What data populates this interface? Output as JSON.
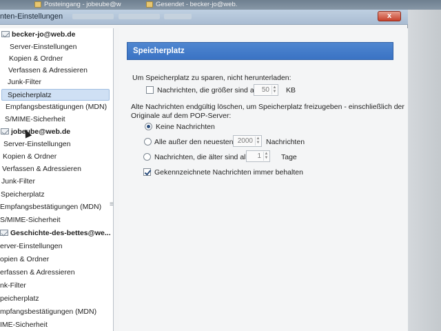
{
  "tabs": [
    {
      "label": "Posteingang - jobeube@w"
    },
    {
      "label": "Gesendet - becker-jo@web."
    }
  ],
  "window": {
    "title": "nten-Einstellungen",
    "close_label": "x"
  },
  "tree": {
    "rows": [
      {
        "label": "becker-jo@web.de",
        "type": "account"
      },
      {
        "label": "Server-Einstellungen",
        "type": "item"
      },
      {
        "label": "Kopien & Ordner",
        "type": "item"
      },
      {
        "label": "Verfassen & Adressieren",
        "type": "item"
      },
      {
        "label": "Junk-Filter",
        "type": "item"
      },
      {
        "label": "Speicherplatz",
        "type": "item",
        "selected": true
      },
      {
        "label": "Empfangsbestätigungen (MDN)",
        "type": "item"
      },
      {
        "label": "S/MIME-Sicherheit",
        "type": "item"
      },
      {
        "label": "jobeube@web.de",
        "type": "account"
      },
      {
        "label": "Server-Einstellungen",
        "type": "item"
      },
      {
        "label": "Kopien & Ordner",
        "type": "item"
      },
      {
        "label": "Verfassen & Adressieren",
        "type": "item"
      },
      {
        "label": "Junk-Filter",
        "type": "item"
      },
      {
        "label": "Speicherplatz",
        "type": "item"
      },
      {
        "label": "Empfangsbestätigungen (MDN)",
        "type": "item"
      },
      {
        "label": "S/MIME-Sicherheit",
        "type": "item"
      },
      {
        "label": "Geschichte-des-bettes@we...",
        "type": "account"
      },
      {
        "label": "erver-Einstellungen",
        "type": "item"
      },
      {
        "label": "opien & Ordner",
        "type": "item"
      },
      {
        "label": "erfassen & Adressieren",
        "type": "item"
      },
      {
        "label": "nk-Filter",
        "type": "item"
      },
      {
        "label": "peicherplatz",
        "type": "item"
      },
      {
        "label": "mpfangsbestätigungen (MDN)",
        "type": "item"
      },
      {
        "label": "IME-Sicherheit",
        "type": "item"
      }
    ]
  },
  "content": {
    "header": "Speicherplatz",
    "save_space_label": "Um Speicherplatz zu sparen, nicht herunterladen:",
    "size_checkbox_label": "Nachrichten, die größer sind als",
    "size_value": "50",
    "size_unit": "KB",
    "delete_label_1": "Alte Nachrichten endgültig löschen, um Speicherplatz freizugeben - einschließlich der",
    "delete_label_2": "Originale auf dem POP-Server:",
    "radio_none": "Keine Nachrichten",
    "radio_newest": "Alle außer den neuesten",
    "newest_value": "2000",
    "newest_unit": "Nachrichten",
    "radio_older": "Nachrichten, die älter sind als",
    "older_value": "1",
    "older_unit": "Tage",
    "keep_flagged_label": "Gekennzeichnete Nachrichten immer behalten"
  }
}
